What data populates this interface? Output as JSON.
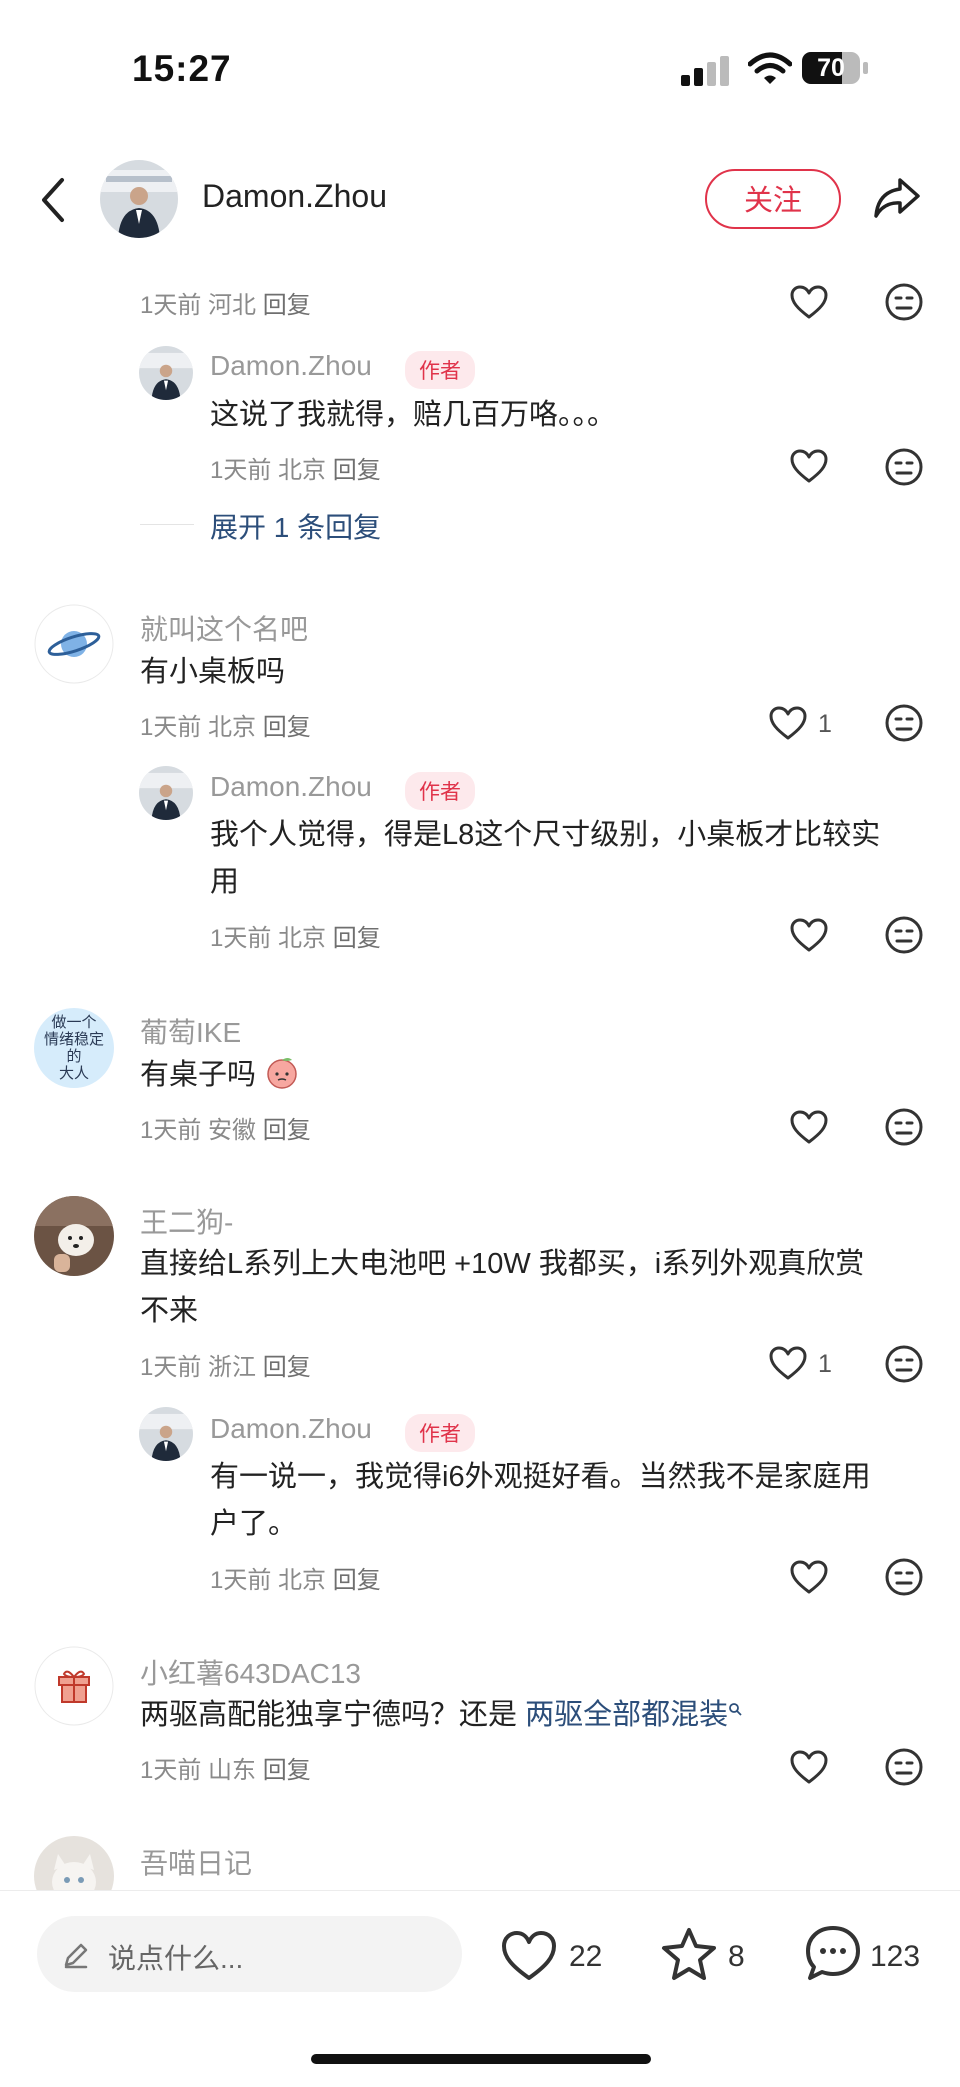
{
  "status_bar": {
    "time": "15:27",
    "battery": "70"
  },
  "header": {
    "username": "Damon.Zhou",
    "follow_label": "关注"
  },
  "comments": [
    {
      "meta": {
        "time": "1天前",
        "location": "河北",
        "reply": "回复"
      },
      "reply": {
        "username": "Damon.Zhou",
        "tag": "作者",
        "text": "这说了我就得，赔几百万咯。。。",
        "meta": {
          "time": "1天前",
          "location": "北京",
          "reply": "回复"
        }
      },
      "expand_label": "展开 1 条回复"
    },
    {
      "username": "就叫这个名吧",
      "text": "有小桌板吗",
      "meta": {
        "time": "1天前",
        "location": "北京",
        "reply": "回复"
      },
      "likes": "1",
      "reply": {
        "username": "Damon.Zhou",
        "tag": "作者",
        "text_line1": "我个人觉得，得是L8这个尺寸级别，小桌板才比较实",
        "text_line2": "用",
        "meta": {
          "time": "1天前",
          "location": "北京",
          "reply": "回复"
        }
      }
    },
    {
      "username": "葡萄IKE",
      "text": "有桌子吗",
      "avatar_text": [
        "做一个",
        "情绪稳定",
        "的",
        "大人"
      ],
      "meta": {
        "time": "1天前",
        "location": "安徽",
        "reply": "回复"
      }
    },
    {
      "username": "王二狗-",
      "text_line1": "直接给L系列上大电池吧 +10W 我都买，i系列外观真欣赏",
      "text_line2": "不来",
      "meta": {
        "time": "1天前",
        "location": "浙江",
        "reply": "回复"
      },
      "likes": "1",
      "reply": {
        "username": "Damon.Zhou",
        "tag": "作者",
        "text_line1": "有一说一，我觉得i6外观挺好看。当然我不是家庭用",
        "text_line2": "户了。",
        "meta": {
          "time": "1天前",
          "location": "北京",
          "reply": "回复"
        }
      }
    },
    {
      "username": "小红薯643DAC13",
      "text_prefix": "两驱高配能独享宁德吗？还是",
      "search_link": "两驱全部都混装",
      "meta": {
        "time": "1天前",
        "location": "山东",
        "reply": "回复"
      }
    },
    {
      "username": "吾喵日记"
    }
  ],
  "bottom_bar": {
    "input_placeholder": "说点什么...",
    "likes": "22",
    "favorites": "8",
    "comments": "123"
  }
}
